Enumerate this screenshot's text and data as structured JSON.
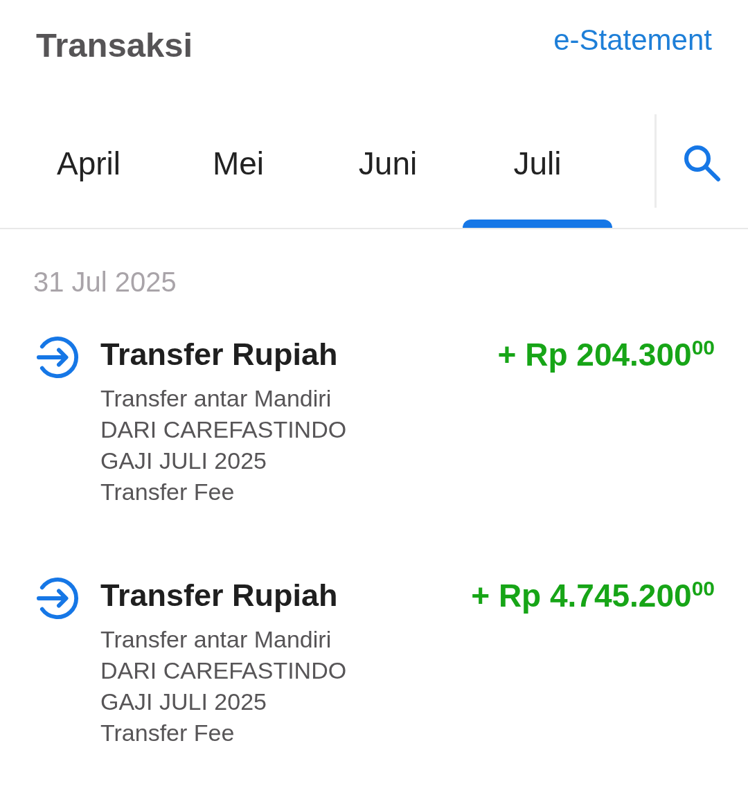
{
  "header": {
    "title": "Transaksi",
    "link": "e-Statement"
  },
  "tabs": [
    {
      "label": "April",
      "selected": false
    },
    {
      "label": "Mei",
      "selected": false
    },
    {
      "label": "Juni",
      "selected": false
    },
    {
      "label": "Juli",
      "selected": true
    }
  ],
  "date_groups": [
    {
      "date": "31 Jul 2025",
      "transactions": [
        {
          "title": "Transfer Rupiah",
          "amount": "+ Rp 204.300$^{00}$",
          "details": [
            "Transfer antar Mandiri",
            "DARI CAREFASTINDO",
            "GAJI JULI 2025",
            "Transfer Fee"
          ]
        },
        {
          "title": "Transfer Rupiah",
          "amount": "+ Rp 4.745.200$^{00}$",
          "details": [
            "Transfer antar Mandiri",
            "DARI CAREFASTINDO",
            "GAJI JULI 2025",
            "Transfer Fee"
          ]
        }
      ]
    }
  ]
}
